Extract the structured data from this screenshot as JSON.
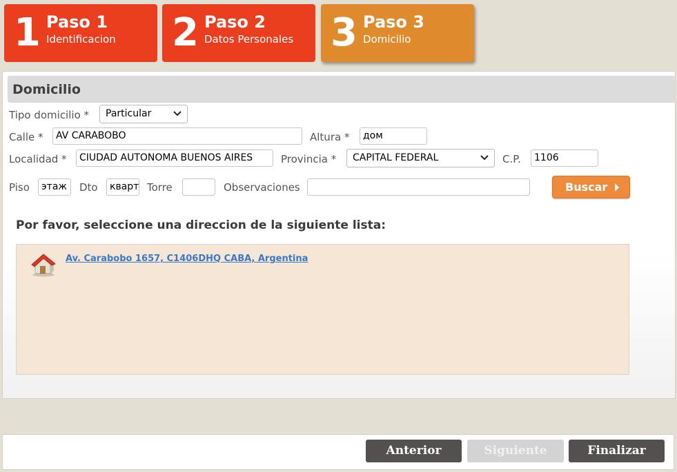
{
  "steps": [
    {
      "num": "1",
      "title": "Paso 1",
      "subtitle": "Identificacion",
      "color": "#ea3e1f"
    },
    {
      "num": "2",
      "title": "Paso 2",
      "subtitle": "Datos Personales",
      "color": "#ea3e1f"
    },
    {
      "num": "3",
      "title": "Paso 3",
      "subtitle": "Domicilio",
      "color": "#df8a2d"
    }
  ],
  "section": {
    "title": "Domicilio"
  },
  "form": {
    "tipo_domicilio": {
      "label": "Tipo domicilio *",
      "value": "Particular"
    },
    "calle": {
      "label": "Calle *",
      "value": "AV CARABOBO"
    },
    "altura": {
      "label": "Altura *",
      "value": "дом"
    },
    "localidad": {
      "label": "Localidad *",
      "value": "CIUDAD AUTONOMA BUENOS AIRES"
    },
    "provincia": {
      "label": "Provincia *",
      "value": "CAPITAL FEDERAL"
    },
    "cp": {
      "label": "C.P.",
      "value": "1106"
    },
    "piso": {
      "label": "Piso",
      "value": "этаж"
    },
    "dto": {
      "label": "Dto",
      "value": "кварт"
    },
    "torre": {
      "label": "Torre",
      "value": ""
    },
    "observaciones": {
      "label": "Observaciones",
      "value": ""
    },
    "buscar_label": "Buscar"
  },
  "results": {
    "prompt": "Por favor, seleccione una direccion de la siguiente lista:",
    "items": [
      {
        "icon": "house-icon",
        "text": "Av. Carabobo 1657, C1406DHQ CABA, Argentina"
      }
    ]
  },
  "footer": {
    "anterior": "Anterior",
    "siguiente": "Siguiente",
    "finalizar": "Finalizar"
  }
}
